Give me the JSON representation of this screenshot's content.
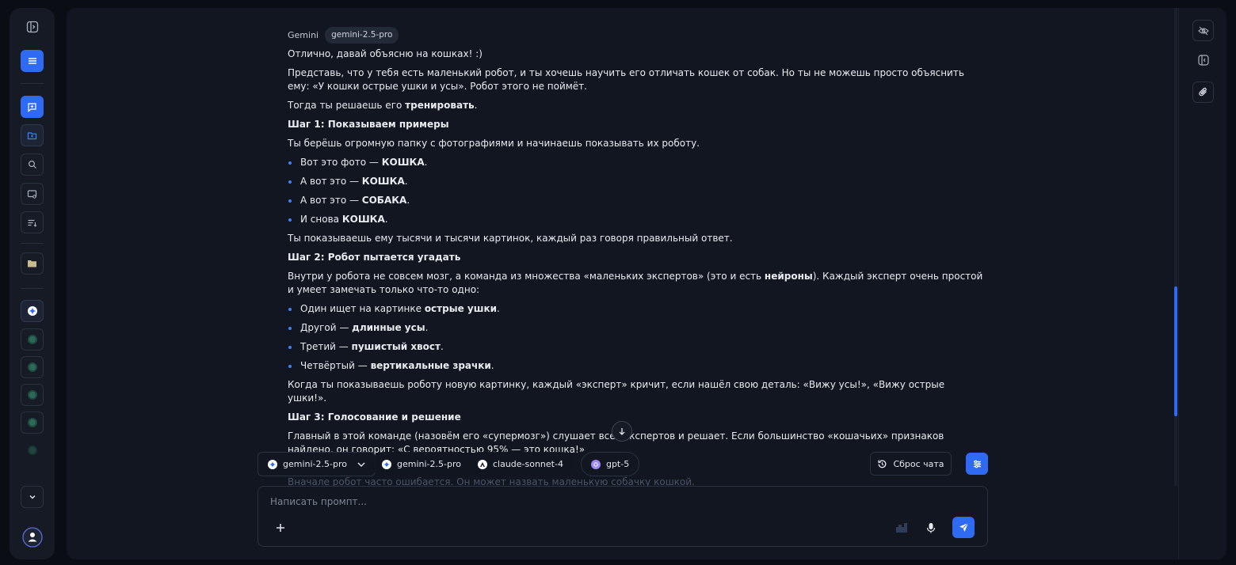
{
  "rail": {
    "icons": [
      "sidebar-toggle-icon",
      "menu-icon",
      "new-chat-icon",
      "folder-add-icon",
      "search-icon",
      "chat-screen-icon",
      "list-sort-icon",
      "folder-icon",
      "gemini-model-icon",
      "model-slot-icon",
      "chevron-down-icon",
      "user-avatar-icon"
    ]
  },
  "message": {
    "author": "Gemini",
    "model": "gemini-2.5-pro",
    "p1": "Отлично, давай объясню на кошках! :)",
    "p2": "Представь, что у тебя есть маленький робот, и ты хочешь научить его отличать кошек от собак. Но ты не можешь просто объяснить ему: «У кошки острые ушки и усы». Робот этого не поймёт.",
    "p3_pre": "Тогда ты решаешь его ",
    "p3_bold": "тренировать",
    "p3_post": ".",
    "step1": "Шаг 1: Показываем примеры",
    "p4": "Ты берёшь огромную папку с фотографиями и начинаешь показывать их роботу.",
    "list1": [
      {
        "pre": "Вот это фото — ",
        "bold": "КОШКА",
        "post": "."
      },
      {
        "pre": "А вот это — ",
        "bold": "КОШКА",
        "post": "."
      },
      {
        "pre": "А вот это — ",
        "bold": "СОБАКА",
        "post": "."
      },
      {
        "pre": "И снова ",
        "bold": "КОШКА",
        "post": "."
      }
    ],
    "p5": "Ты показываешь ему тысячи и тысячи картинок, каждый раз говоря правильный ответ.",
    "step2": "Шаг 2: Робот пытается угадать",
    "p6_pre": "Внутри у робота не совсем мозг, а команда из множества «маленьких экспертов» (это и есть ",
    "p6_bold": "нейроны",
    "p6_post": "). Каждый эксперт очень простой и умеет замечать только что-то одно:",
    "list2": [
      {
        "pre": "Один ищет на картинке ",
        "bold": "острые ушки",
        "post": "."
      },
      {
        "pre": "Другой — ",
        "bold": "длинные усы",
        "post": "."
      },
      {
        "pre": "Третий — ",
        "bold": "пушистый хвост",
        "post": "."
      },
      {
        "pre": "Четвёртый — ",
        "bold": "вертикальные зрачки",
        "post": "."
      }
    ],
    "p7": "Когда ты показываешь роботу новую картинку, каждый «эксперт» кричит, если нашёл свою деталь: «Вижу усы!», «Вижу острые ушки!».",
    "step3": "Шаг 3: Голосование и решение",
    "p8": "Главный в этой команде (назовём его «супермозг») слушает всех экспертов и решает. Если большинство «кошачьих» признаков найдено, он говорит: «С вероятностью 95% — это кошка!»",
    "p9_faded": "Вначале робот часто ошибается. Он может назвать маленькую собачку кошкой."
  },
  "models": {
    "selected": "gemini-2.5-pro",
    "chips": [
      "gemini-2.5-pro",
      "claude-sonnet-4",
      "gpt-5"
    ]
  },
  "toolbar": {
    "reset_label": "Сброс чата"
  },
  "prompt": {
    "placeholder": "Написать промпт..."
  },
  "colors": {
    "accent": "#2f6bf2",
    "background": "#111620",
    "rail": "#151a25"
  }
}
